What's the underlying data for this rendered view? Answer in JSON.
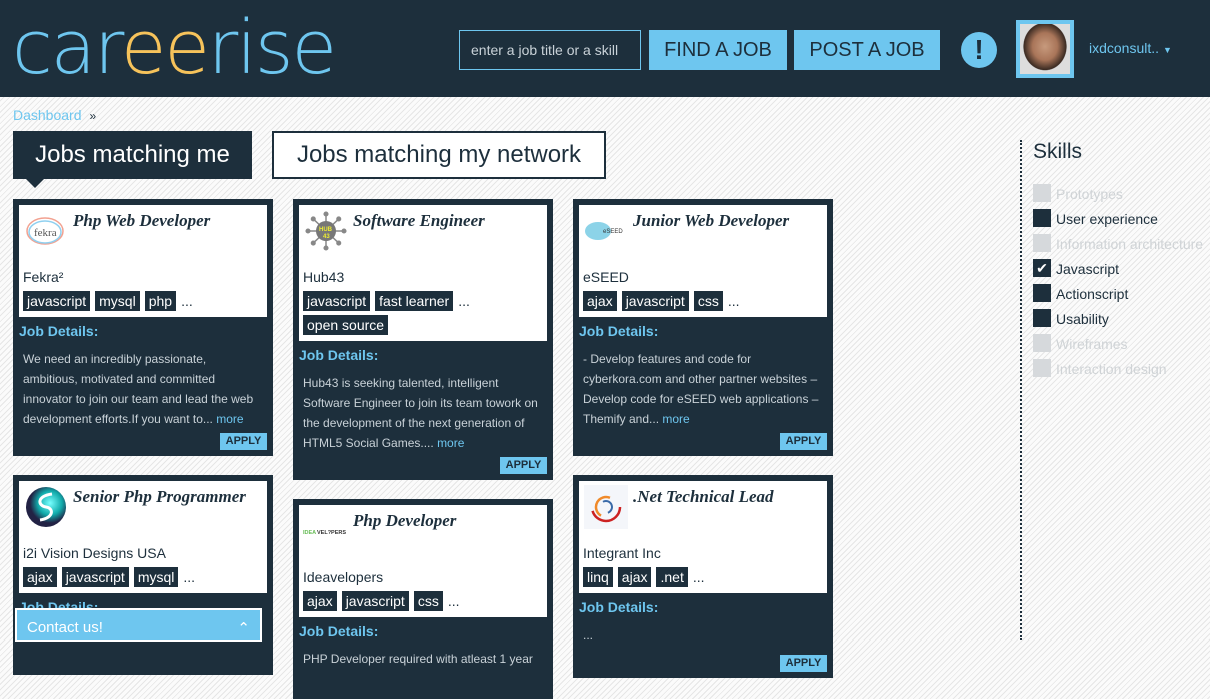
{
  "header": {
    "logo": {
      "a": "car",
      "b": "ee",
      "c": "rise"
    },
    "search_placeholder": "enter a job title or a skill",
    "find_job": "FIND A JOB",
    "post_job": "POST A JOB",
    "alert": "!",
    "username": "ixdconsult..",
    "colors": {
      "dark": "#1d2f3c",
      "accent": "#6ec6ef",
      "logo_yellow": "#f6c35b"
    }
  },
  "breadcrumb": {
    "item": "Dashboard",
    "sep": "»"
  },
  "tabs": [
    {
      "label": "Jobs matching me",
      "active": true
    },
    {
      "label": "Jobs matching my network",
      "active": false
    }
  ],
  "jobs": [
    {
      "title": "Php Web Developer",
      "company": "Fekra²",
      "logo": "fekra",
      "tags": [
        "javascript",
        "mysql",
        "php"
      ],
      "details_label": "Job Details:",
      "desc": "We need an incredibly passionate, ambitious, motivated and committed innovator to join our team and lead the web development efforts.If you want to...",
      "more": "more",
      "apply": "APPLY"
    },
    {
      "title": "Senior Php Programmer",
      "company": "i2i Vision Designs USA",
      "logo": "i2i",
      "tags": [
        "ajax",
        "javascript",
        "mysql"
      ],
      "details_label": "Job Details:"
    },
    {
      "title": "Software Engineer",
      "company": "Hub43",
      "logo": "HUB 43",
      "tags": [
        "javascript",
        "fast learner",
        "open source"
      ],
      "details_label": "Job Details:",
      "desc": "Hub43 is seeking talented, intelligent Software Engineer to join its team towork on the development of the next generation of HTML5 Social Games....",
      "more": "more",
      "apply": "APPLY"
    },
    {
      "title": "Php Developer",
      "company": "Ideavelopers",
      "logo": "IDEAVELOPERS",
      "tags": [
        "ajax",
        "javascript",
        "css"
      ],
      "details_label": "Job Details:",
      "desc": "PHP Developer required with atleast 1 year"
    },
    {
      "title": "Junior Web Developer",
      "company": "eSEED",
      "logo": "eSEED",
      "tags": [
        "ajax",
        "javascript",
        "css"
      ],
      "details_label": "Job Details:",
      "desc": "- Develop features and code for cyberkora.com and other partner websites – Develop code for eSEED web applications – Themify and...",
      "more": "more",
      "apply": "APPLY"
    },
    {
      "title": ".Net Technical Lead",
      "company": "Integrant Inc",
      "logo": "integrant",
      "tags": [
        "linq",
        "ajax",
        ".net"
      ],
      "details_label": "Job Details:",
      "desc": "...",
      "apply": "APPLY"
    }
  ],
  "ellipsis": "...",
  "contact": {
    "label": "Contact us!",
    "icon": "chevron-up"
  },
  "skills": {
    "title": "Skills",
    "items": [
      {
        "label": "Prototypes",
        "state": "disabled"
      },
      {
        "label": "User experience",
        "state": "unchecked"
      },
      {
        "label": "Information architecture",
        "state": "disabled"
      },
      {
        "label": "Javascript",
        "state": "checked"
      },
      {
        "label": "Actionscript",
        "state": "unchecked"
      },
      {
        "label": "Usability",
        "state": "unchecked"
      },
      {
        "label": "Wireframes",
        "state": "disabled"
      },
      {
        "label": "Interaction design",
        "state": "disabled"
      }
    ]
  }
}
